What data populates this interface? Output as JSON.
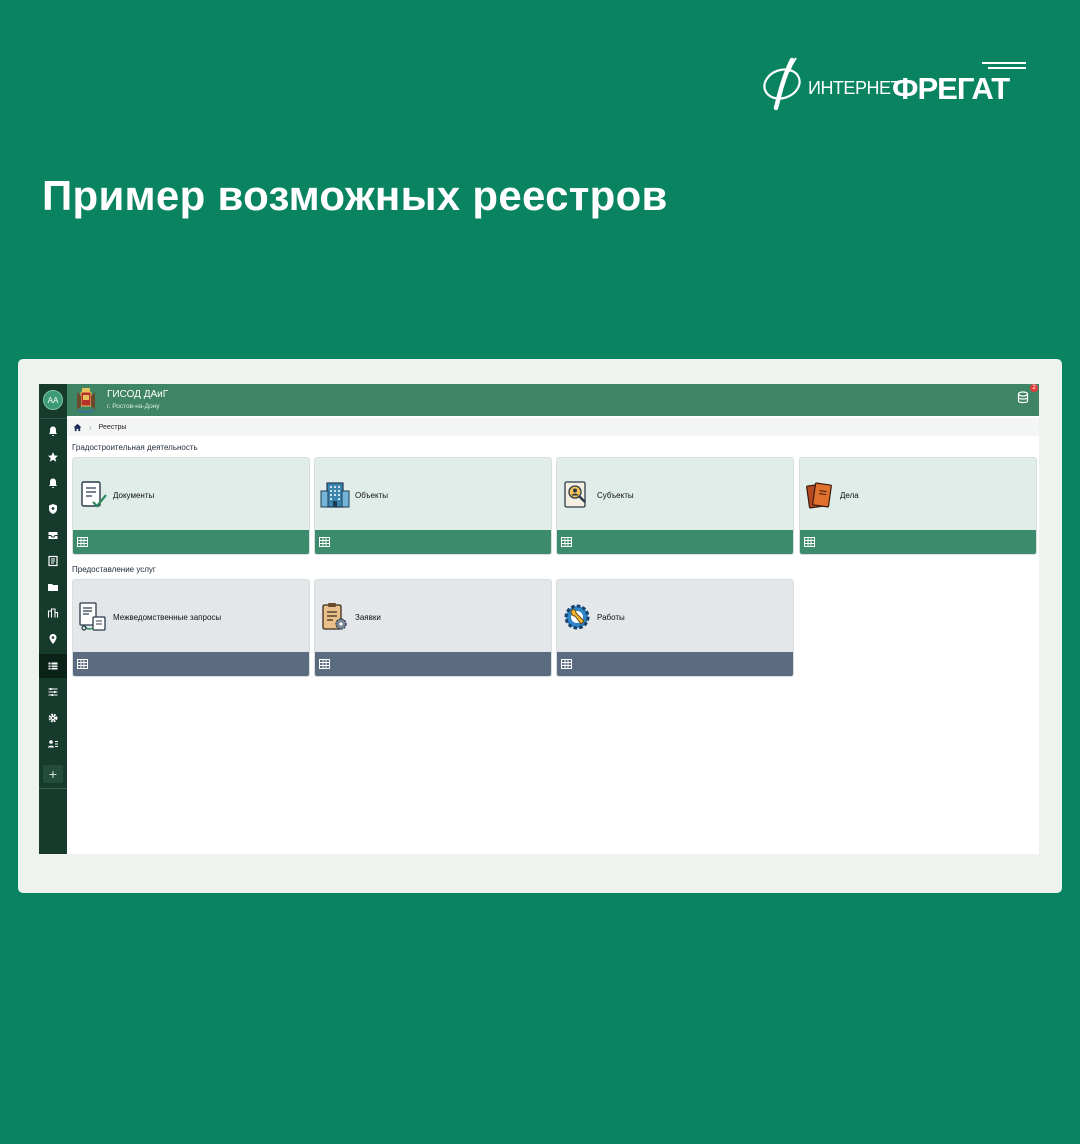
{
  "brand": {
    "small": "ИНТЕРНЕТ",
    "big": "ФРЕГАТ"
  },
  "hero": {
    "title": "Пример возможных реестров"
  },
  "app": {
    "avatar": "AA",
    "title": "ГИСОД ДАиГ",
    "subtitle": "г. Ростов-на-Дону",
    "notification_count": "2",
    "breadcrumb": {
      "current": "Реестры"
    },
    "sidebar_icons": [
      "notifications-icon",
      "star-icon",
      "bell-icon",
      "shield-icon",
      "inbox-icon",
      "journal-icon",
      "folder-icon",
      "buildings-icon",
      "location-icon",
      "registries-icon",
      "sliders-icon",
      "gear-icon",
      "users-list-icon"
    ],
    "sections": [
      {
        "title": "Градостроительная деятельность",
        "color": "#3b8b6c",
        "cards": [
          {
            "label": "Документы",
            "icon": "document-check-icon"
          },
          {
            "label": "Объекты",
            "icon": "building-icon"
          },
          {
            "label": "Субъекты",
            "icon": "person-search-icon"
          },
          {
            "label": "Дела",
            "icon": "folders-icon"
          }
        ]
      },
      {
        "title": "Предоставление услуг",
        "color": "#5b6c80",
        "cards": [
          {
            "label": "Межведомственные запросы",
            "icon": "request-icon"
          },
          {
            "label": "Заявки",
            "icon": "clipboard-gear-icon"
          },
          {
            "label": "Работы",
            "icon": "wrench-gear-icon"
          }
        ]
      }
    ]
  }
}
